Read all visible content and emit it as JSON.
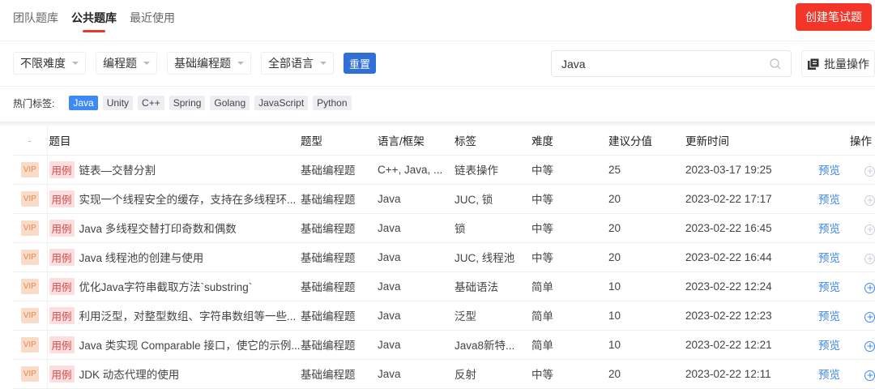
{
  "tabs": [
    "团队题库",
    "公共题库",
    "最近使用"
  ],
  "create_label": "创建笔试题",
  "filters": [
    "不限难度",
    "编程题",
    "基础编程题",
    "全部语言"
  ],
  "reset_label": "重置",
  "search": {
    "value": "Java"
  },
  "batch_label": "批量操作",
  "hot": {
    "label": "热门标签:",
    "tags": [
      "Java",
      "Unity",
      "C++",
      "Spring",
      "Golang",
      "JavaScript",
      "Python"
    ]
  },
  "columns": [
    "-",
    "题目",
    "题型",
    "语言/框架",
    "标签",
    "难度",
    "建议分值",
    "更新时间",
    "操作"
  ],
  "vip": "VIP",
  "case": "用例",
  "preview": "预览",
  "rows": [
    {
      "title": "链表—交替分割",
      "type": "基础编程题",
      "lang": "C++, Java, ...",
      "tag": "链表操作",
      "diff": "中等",
      "score": "25",
      "time": "2023-03-17 19:25",
      "active": false
    },
    {
      "title": "实现一个线程安全的缓存，支持在多线程环...",
      "type": "基础编程题",
      "lang": "Java",
      "tag": "JUC, 锁",
      "diff": "中等",
      "score": "20",
      "time": "2023-02-22 17:17",
      "active": false
    },
    {
      "title": "Java 多线程交替打印奇数和偶数",
      "type": "基础编程题",
      "lang": "Java",
      "tag": "锁",
      "diff": "中等",
      "score": "20",
      "time": "2023-02-22 16:45",
      "active": false
    },
    {
      "title": "Java 线程池的创建与使用",
      "type": "基础编程题",
      "lang": "Java",
      "tag": "JUC, 线程池",
      "diff": "中等",
      "score": "20",
      "time": "2023-02-22 16:44",
      "active": false
    },
    {
      "title": "优化Java字符串截取方法`substring`",
      "type": "基础编程题",
      "lang": "Java",
      "tag": "基础语法",
      "diff": "简单",
      "score": "10",
      "time": "2023-02-22 12:24",
      "active": true
    },
    {
      "title": "利用泛型，对整型数组、字符串数组等一些...",
      "type": "基础编程题",
      "lang": "Java",
      "tag": "泛型",
      "diff": "简单",
      "score": "10",
      "time": "2023-02-22 12:23",
      "active": true
    },
    {
      "title": "Java 类实现 Comparable 接口，使它的示例...",
      "type": "基础编程题",
      "lang": "Java",
      "tag": "Java8新特...",
      "diff": "简单",
      "score": "10",
      "time": "2023-02-22 12:21",
      "active": true
    },
    {
      "title": "JDK 动态代理的使用",
      "type": "基础编程题",
      "lang": "Java",
      "tag": "反射",
      "diff": "中等",
      "score": "20",
      "time": "2023-02-22 12:11",
      "active": true
    }
  ]
}
